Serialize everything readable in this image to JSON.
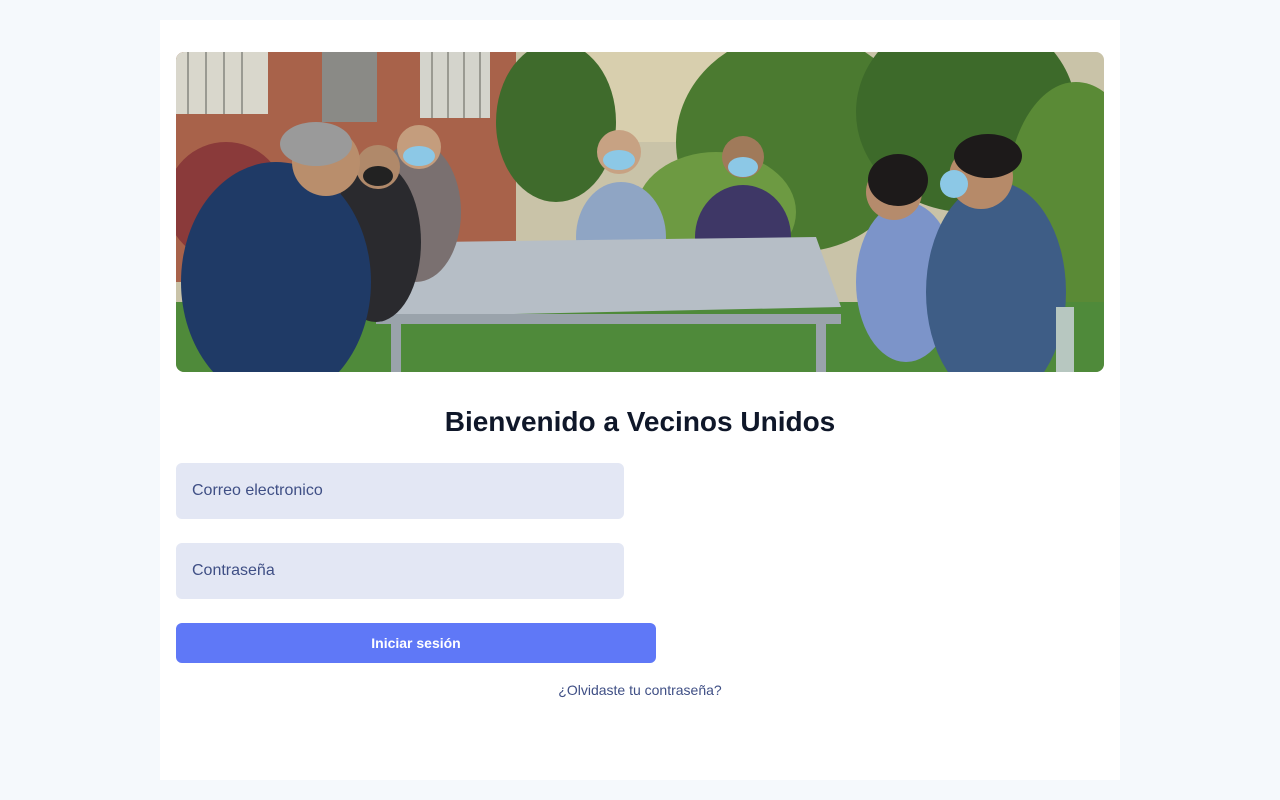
{
  "hero": {
    "image": "community-meeting-photo"
  },
  "login": {
    "title": "Bienvenido a Vecinos Unidos",
    "email_placeholder": "Correo electronico",
    "password_placeholder": "Contraseña",
    "submit_label": "Iniciar sesión",
    "forgot_label": "¿Olvidaste tu contraseña?"
  },
  "colors": {
    "page_background": "#f5f9fc",
    "card_background": "#ffffff",
    "input_background": "#e3e7f4",
    "button_background": "#5f78f7",
    "link_color": "#3f4f85",
    "title_color": "#0f1729"
  }
}
